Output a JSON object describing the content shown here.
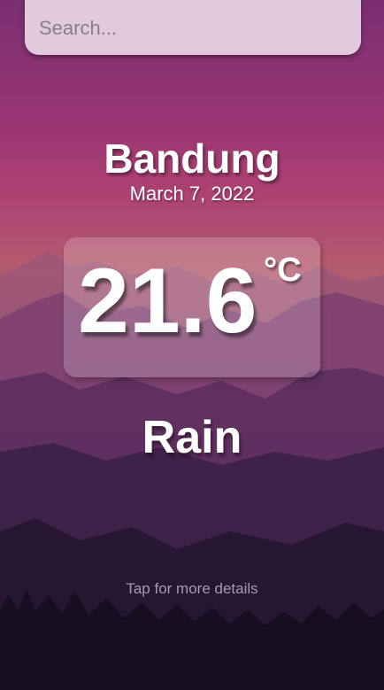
{
  "search": {
    "placeholder": "Search...",
    "value": ""
  },
  "location": {
    "city": "Bandung",
    "date": "March 7, 2022"
  },
  "weather": {
    "temperature": "21.6",
    "unit": "°C",
    "condition": "Rain"
  },
  "footer": {
    "details_label": "Tap for more details"
  },
  "colors": {
    "sky_top": "#7a2f72",
    "sky_mid": "#b45e6e",
    "ground": "#120d1e",
    "search_bg": "#e9d6e6",
    "details_text": "#a59bb0"
  }
}
